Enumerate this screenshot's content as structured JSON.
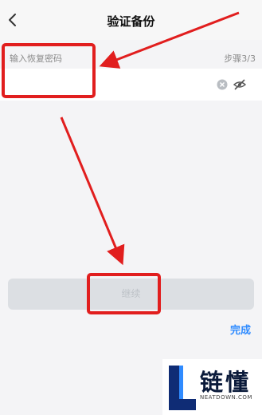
{
  "nav": {
    "title": "验证备份"
  },
  "form": {
    "field_label": "输入恢复密码",
    "step": "步骤3/3",
    "input_value": ""
  },
  "actions": {
    "continue_label": "继续",
    "done_label": "完成"
  },
  "watermark": {
    "cn": "链懂",
    "en": "NEATDOWN.COM"
  },
  "colors": {
    "accent": "#2f8bff",
    "annotation": "#e11e1e",
    "button_disabled": "#dcdfe3"
  }
}
